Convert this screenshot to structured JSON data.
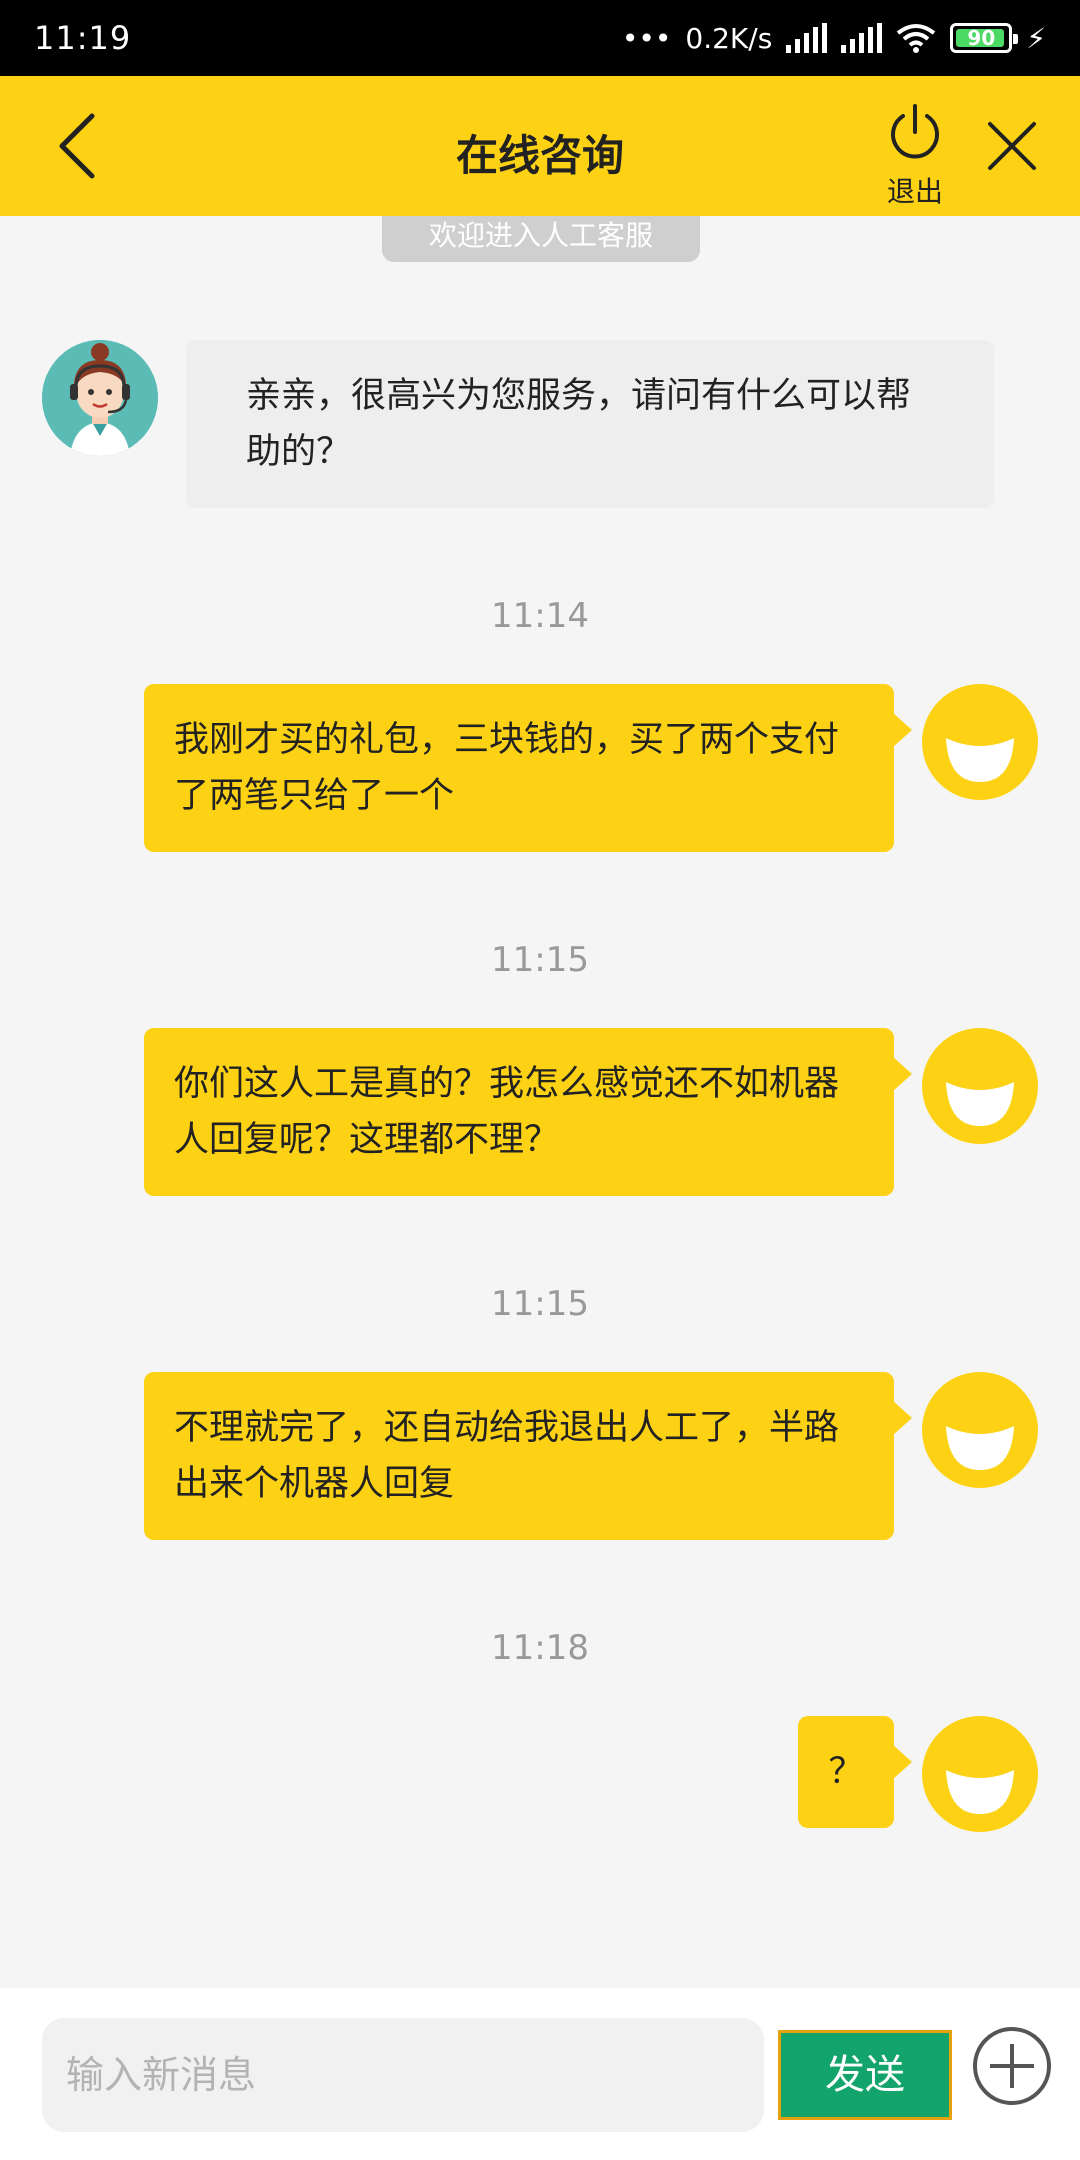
{
  "status_bar": {
    "time": "11:19",
    "network_speed": "0.2K/s",
    "battery_level": "90",
    "icons": [
      "more-dots-icon",
      "signal-icon",
      "signal-icon",
      "wifi-icon",
      "battery-icon",
      "charging-icon"
    ]
  },
  "header": {
    "title": "在线咨询",
    "exit_label": "退出",
    "back_icon": "chevron-left-icon",
    "power_icon": "power-icon",
    "close_icon": "close-icon",
    "accent_color": "#fdd214"
  },
  "chat": {
    "banner": "欢迎进入人工客服",
    "agent_message": "亲亲，很高兴为您服务，请问有什么可以帮助的？",
    "messages": [
      {
        "time": "11:14",
        "text": "我刚才买的礼包，三块钱的，买了两个支付了两笔只给了一个"
      },
      {
        "time": "11:15",
        "text": "你们这人工是真的？我怎么感觉还不如机器人回复呢？这理都不理？"
      },
      {
        "time": "11:15",
        "text": "不理就完了，还自动给我退出人工了，半路出来个机器人回复"
      },
      {
        "time": "11:18",
        "text": "？"
      }
    ]
  },
  "input_bar": {
    "placeholder": "输入新消息",
    "send_label": "发送",
    "send_color": "#12a46a",
    "plus_icon": "plus-circle-icon"
  }
}
